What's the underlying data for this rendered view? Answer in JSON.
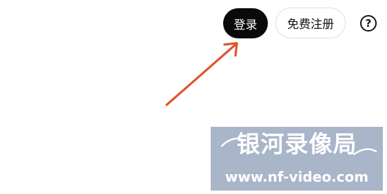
{
  "header": {
    "login_label": "登录",
    "signup_label": "免费注册",
    "help_icon": "question-circle-icon",
    "help_glyph": "?"
  },
  "annotation": {
    "arrow_icon": "red-arrow-icon",
    "arrow_color": "#e0532f"
  },
  "watermark": {
    "title": "银河录像局",
    "url": "www.nf-video.com",
    "background_color": "#a9b5c8"
  }
}
